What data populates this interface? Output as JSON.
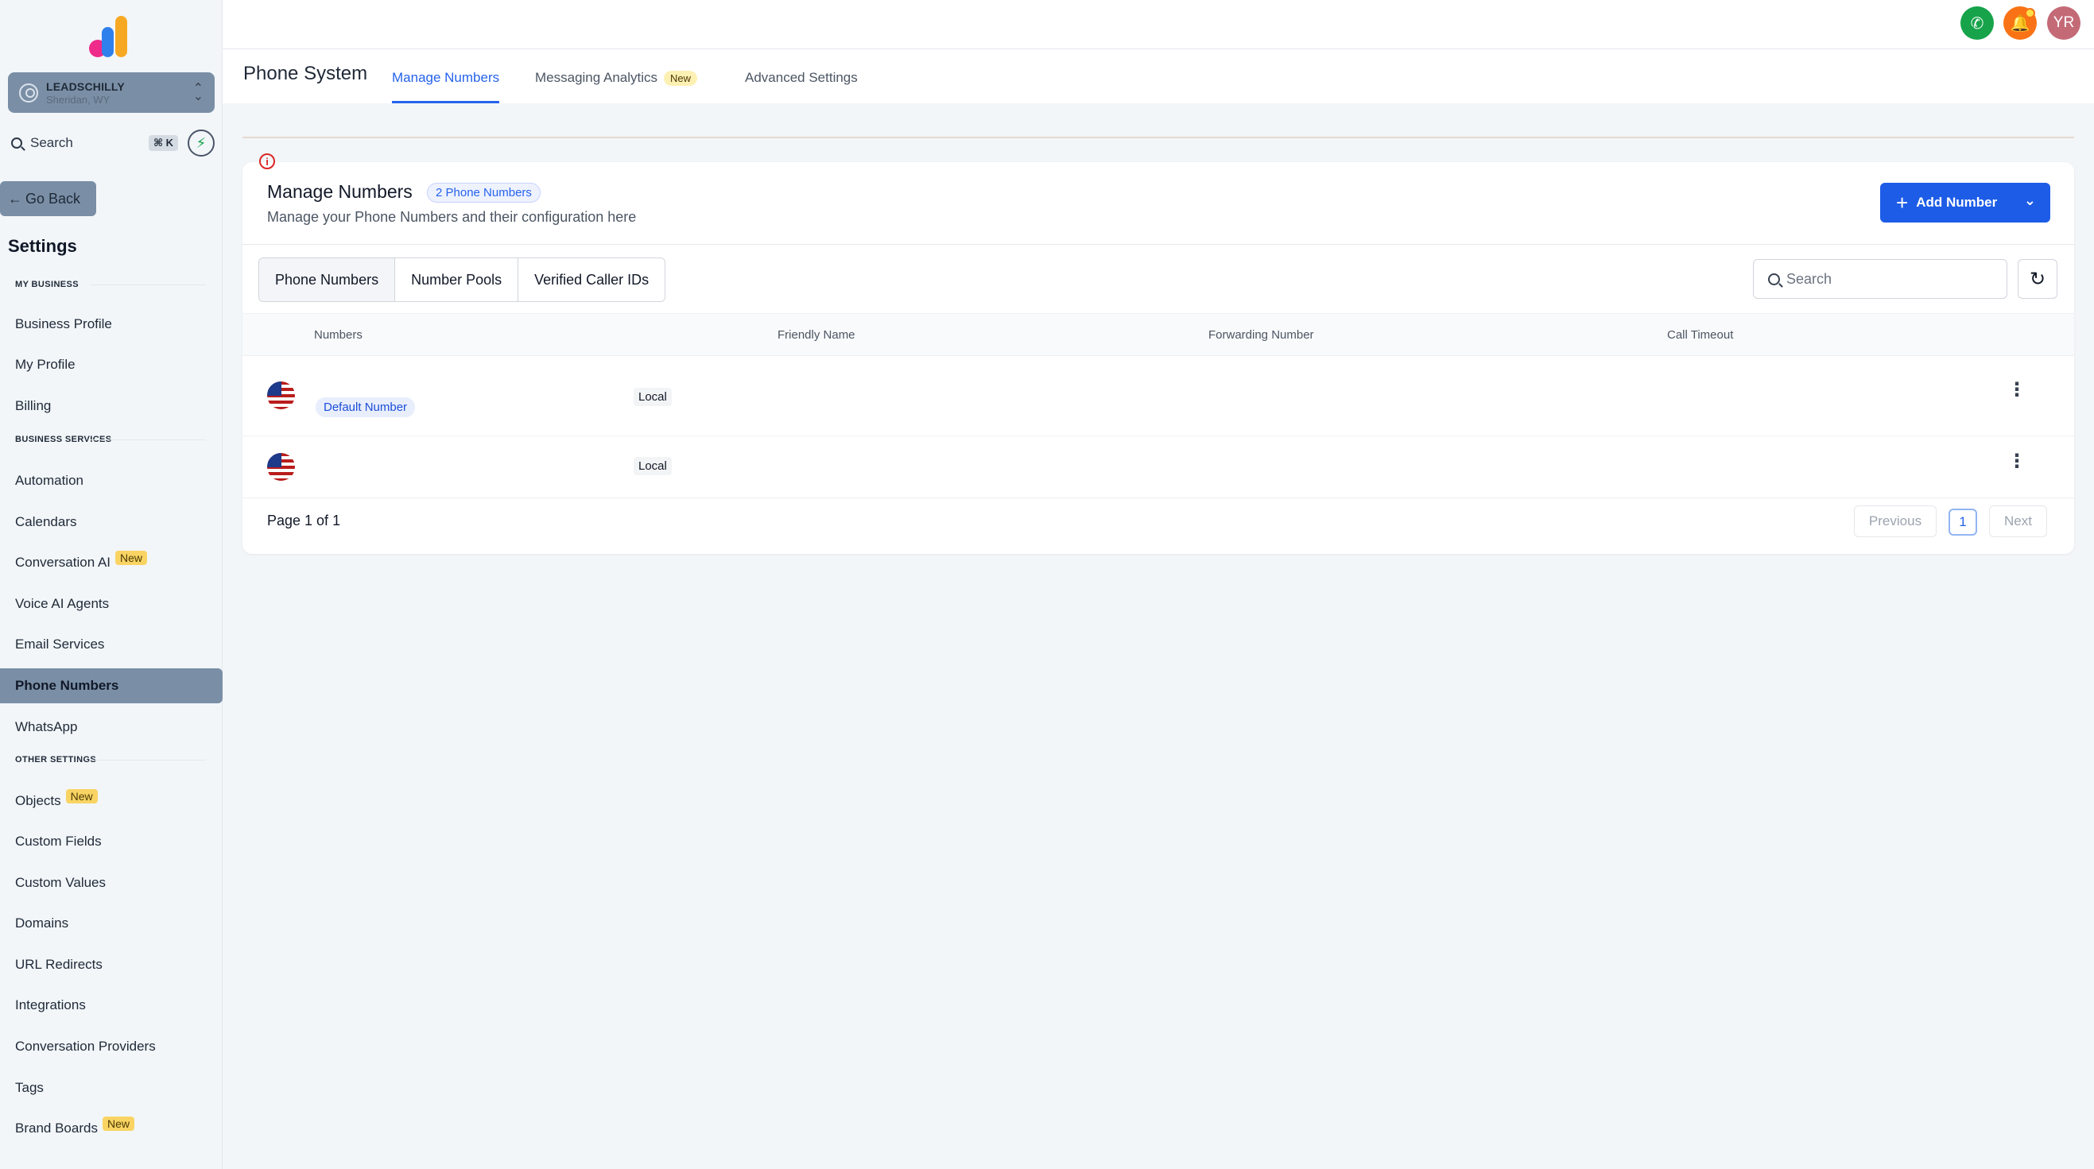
{
  "sidebar": {
    "account": {
      "name": "LEADSCHILLY",
      "location": "Sheridan, WY"
    },
    "search": {
      "label": "Search",
      "shortcut": "⌘ K"
    },
    "go_back": "Go Back",
    "title": "Settings",
    "sections": {
      "my_business": "MY BUSINESS",
      "business_services": "BUSINESS SERVICES",
      "other_settings": "OTHER SETTINGS"
    },
    "items": {
      "business_profile": "Business Profile",
      "my_profile": "My Profile",
      "billing": "Billing",
      "automation": "Automation",
      "calendars": "Calendars",
      "conversation_ai": "Conversation AI",
      "voice_ai_agents": "Voice AI Agents",
      "email_services": "Email Services",
      "phone_numbers": "Phone Numbers",
      "whatsapp": "WhatsApp",
      "objects": "Objects",
      "custom_fields": "Custom Fields",
      "custom_values": "Custom Values",
      "domains": "Domains",
      "url_redirects": "URL Redirects",
      "integrations": "Integrations",
      "conversation_providers": "Conversation Providers",
      "tags": "Tags",
      "brand_boards": "Brand Boards"
    },
    "new_badge": "New"
  },
  "topbar": {
    "avatar_initials": "YR"
  },
  "header": {
    "title": "Phone System",
    "tabs": {
      "manage_numbers": "Manage Numbers",
      "messaging_analytics": "Messaging Analytics",
      "advanced_settings": "Advanced Settings"
    },
    "new_badge": "New"
  },
  "card": {
    "title": "Manage Numbers",
    "count_badge": "2 Phone Numbers",
    "subtitle": "Manage your Phone Numbers and their configuration here",
    "add_button": "Add Number",
    "segments": {
      "phone_numbers": "Phone Numbers",
      "number_pools": "Number Pools",
      "verified_caller_ids": "Verified Caller IDs"
    },
    "search_placeholder": "Search",
    "columns": {
      "numbers": "Numbers",
      "friendly_name": "Friendly Name",
      "forwarding_number": "Forwarding Number",
      "call_timeout": "Call Timeout"
    },
    "rows": [
      {
        "badge": "Default Number",
        "type": "Local"
      },
      {
        "badge": "",
        "type": "Local"
      }
    ],
    "pagination": {
      "text": "Page 1 of 1",
      "previous": "Previous",
      "current": "1",
      "next": "Next"
    }
  },
  "colors": {
    "primary": "#1d5ce6",
    "active_nav": "#7a8fa6",
    "new_badge": "#f9d463",
    "phone_button": "#16a34a",
    "bell_button": "#f97316",
    "avatar": "#c46a77"
  }
}
